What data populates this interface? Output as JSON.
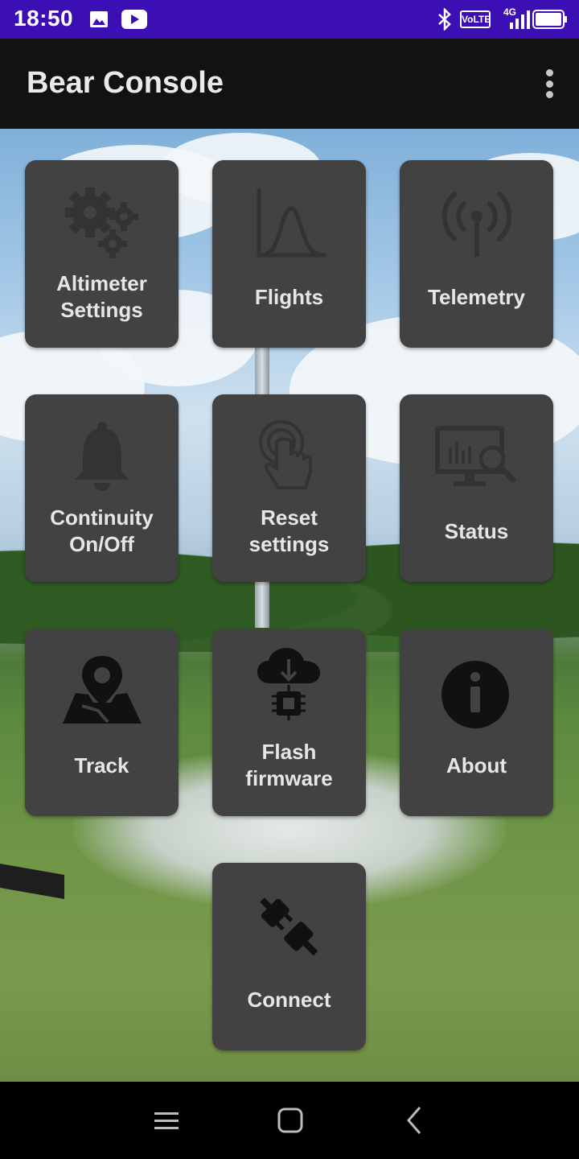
{
  "status_bar": {
    "time": "18:50",
    "icons": [
      "image-icon",
      "youtube-icon",
      "bluetooth-icon",
      "volte-icon",
      "signal-4g-icon",
      "battery-icon"
    ],
    "volte_label": "VoLTE",
    "network_label": "4G",
    "color": "#3b0fb3"
  },
  "app_bar": {
    "title": "Bear Console",
    "menu_icon": "more-vert-icon"
  },
  "tiles": [
    {
      "label": "Altimeter\nSettings",
      "icon": "gears-icon"
    },
    {
      "label": "Flights",
      "icon": "bell-curve-chart-icon"
    },
    {
      "label": "Telemetry",
      "icon": "antenna-icon"
    },
    {
      "label": "Continuity\nOn/Off",
      "icon": "bell-icon"
    },
    {
      "label": "Reset\nsettings",
      "icon": "touch-hand-icon"
    },
    {
      "label": "Status",
      "icon": "monitor-search-icon"
    },
    {
      "label": "Track",
      "icon": "map-pin-icon"
    },
    {
      "label": "Flash\nfirmware",
      "icon": "cloud-download-chip-icon"
    },
    {
      "label": "About",
      "icon": "info-icon"
    },
    {
      "label": "Connect",
      "icon": "plug-disconnected-icon"
    }
  ],
  "nav_bar": {
    "buttons": [
      "menu-icon",
      "home-icon",
      "back-icon"
    ]
  },
  "colors": {
    "tile_bg": "#424242",
    "tile_text": "#e6e6e6",
    "app_bar_bg": "#121212"
  }
}
